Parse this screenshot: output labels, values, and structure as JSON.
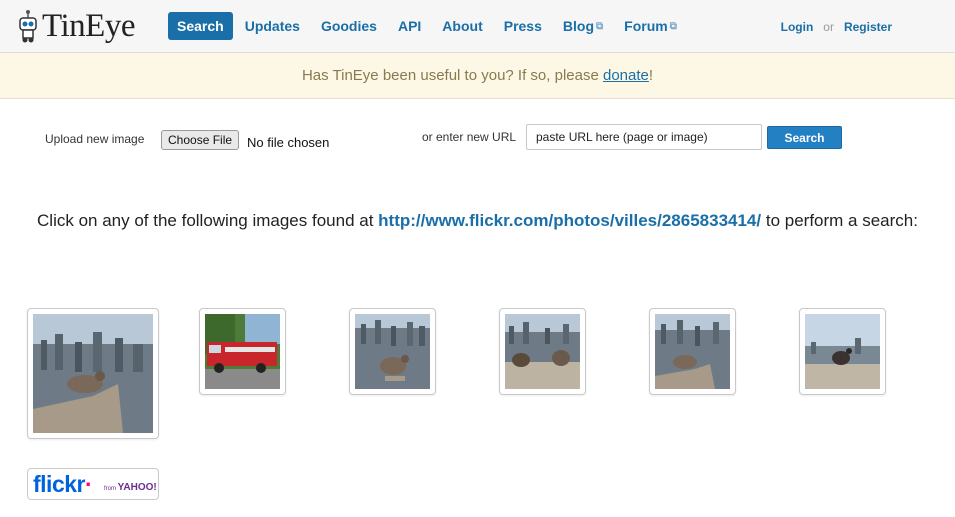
{
  "header": {
    "logo_text": "TinEye",
    "nav": [
      {
        "label": "Search",
        "active": true
      },
      {
        "label": "Updates"
      },
      {
        "label": "Goodies"
      },
      {
        "label": "API"
      },
      {
        "label": "About"
      },
      {
        "label": "Press"
      },
      {
        "label": "Blog",
        "external": true
      },
      {
        "label": "Forum",
        "external": true
      }
    ],
    "login": "Login",
    "or": "or",
    "register": "Register"
  },
  "banner": {
    "text": "Has TinEye been useful to you? If so, please ",
    "link": "donate",
    "end": "!"
  },
  "upload": {
    "label": "Upload new image",
    "button": "Choose File",
    "status": "No file chosen"
  },
  "url_search": {
    "label": "or enter new URL",
    "value": "paste URL here (page or image)",
    "button": "Search"
  },
  "instruction": {
    "before": "Click on any of the following images found at ",
    "link": "http://www.flickr.com/photos/villes/2865833414/",
    "after": " to perform a search:"
  },
  "colors": {
    "link": "#1a6fa8",
    "banner_bg": "#fcf8e5",
    "banner_text": "#8a7a4e",
    "button_bg": "#2280c3"
  },
  "flickr_badge": {
    "brand": "flickr",
    "from": "from",
    "yahoo": "YAHOO!"
  }
}
